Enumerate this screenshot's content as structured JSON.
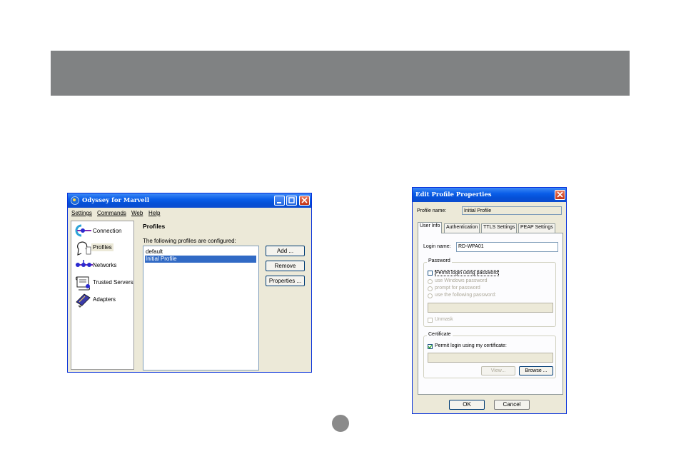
{
  "odyssey": {
    "title": "Odyssey for Marvell",
    "menu": [
      "Settings",
      "Commands",
      "Web",
      "Help"
    ],
    "nav": [
      {
        "label": "Connection",
        "icon": "connection-icon"
      },
      {
        "label": "Profiles",
        "icon": "profiles-icon"
      },
      {
        "label": "Networks",
        "icon": "networks-icon"
      },
      {
        "label": "Trusted Servers",
        "icon": "trusted-servers-icon"
      },
      {
        "label": "Adapters",
        "icon": "adapters-icon"
      }
    ],
    "panel_title": "Profiles",
    "panel_desc": "The following profiles are configured:",
    "profiles": [
      "default",
      "Initial Profile"
    ],
    "selected_profile": "Initial Profile",
    "buttons": {
      "add": "Add ...",
      "remove": "Remove",
      "properties": "Properties ..."
    }
  },
  "edit": {
    "title": "Edit Profile Properties",
    "profile_name_label": "Profile name:",
    "profile_name_value": "Initial Profile",
    "tabs": [
      "User Info",
      "Authentication",
      "TTLS Settings",
      "PEAP Settings"
    ],
    "active_tab": "User Info",
    "login_name_label": "Login name:",
    "login_name_value": "RD-WPA01",
    "password_group": "Password",
    "permit_password": "Permit login using password",
    "use_windows_password": "use Windows password",
    "prompt_password": "prompt for password",
    "use_following_password": "use the following password:",
    "unmask": "Unmask",
    "certificate_group": "Certificate",
    "permit_certificate": "Permit login using my certificate:",
    "view_button": "View...",
    "browse_button": "Browse ...",
    "ok_button": "OK",
    "cancel_button": "Cancel"
  },
  "colors": {
    "banner": "#808283",
    "title_blue": "#0550d6",
    "selection": "#316ac5"
  }
}
